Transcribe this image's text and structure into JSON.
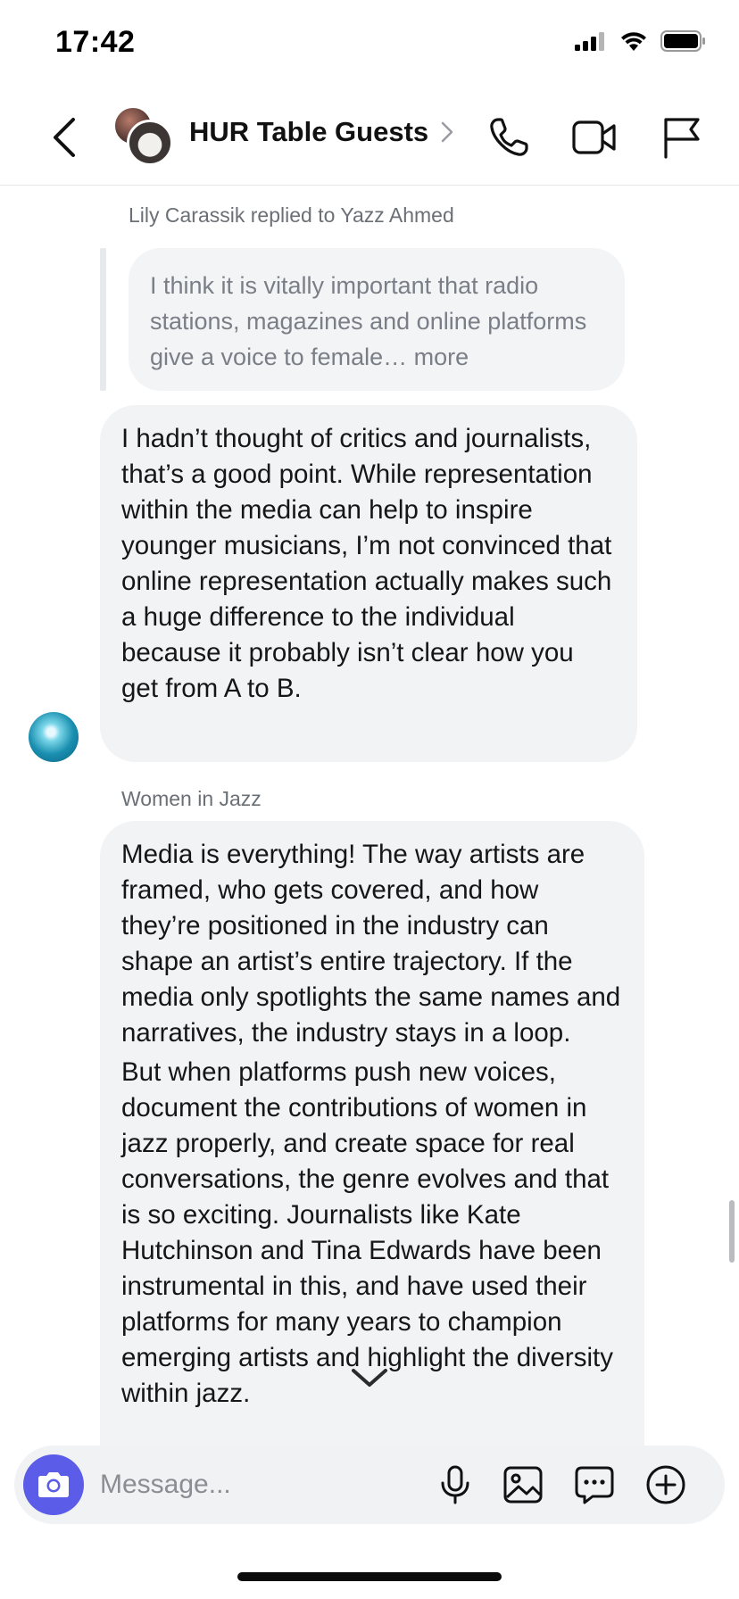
{
  "status_bar": {
    "time": "17:42"
  },
  "header": {
    "title": "HUR Table Guests",
    "icons": [
      "back-icon",
      "chevron-right-icon",
      "phone-icon",
      "video-icon",
      "flag-icon"
    ]
  },
  "messages": {
    "reply_meta": "Lily Carassik replied to Yazz Ahmed",
    "quoted_text": "I think it is vitally important that radio stations, magazines and online platforms give a voice to female…",
    "quoted_more": "more",
    "message1": "I hadn’t thought of critics and journalists, that’s a good point. While representation within the media can help to inspire younger musicians, I’m not convinced that online representation actually makes such a huge difference to the individual because it probably isn’t clear how you get from A to B.",
    "sender2": "Women in Jazz",
    "message2_p1": "Media is everything! The way artists are framed, who gets covered, and how they’re positioned in the industry can shape an artist’s entire trajectory. If the media only spotlights the same names and narratives, the industry stays in a loop.",
    "message2_p2": "But when platforms push new voices, document the contributions of women in jazz properly, and create space for real conversations, the genre evolves and that is so exciting. Journalists like Kate Hutchinson and Tina Edwards have been instrumental in this, and have used their platforms for many years to champion emerging artists and highlight the diversity within jazz."
  },
  "composer": {
    "placeholder": "Message...",
    "icons": [
      "camera-icon",
      "microphone-icon",
      "image-icon",
      "chat-bubble-icon",
      "plus-circle-icon"
    ]
  },
  "colors": {
    "accent": "#5b5ce8",
    "bubble": "#f2f3f5",
    "meta_text": "#6b6f76"
  }
}
